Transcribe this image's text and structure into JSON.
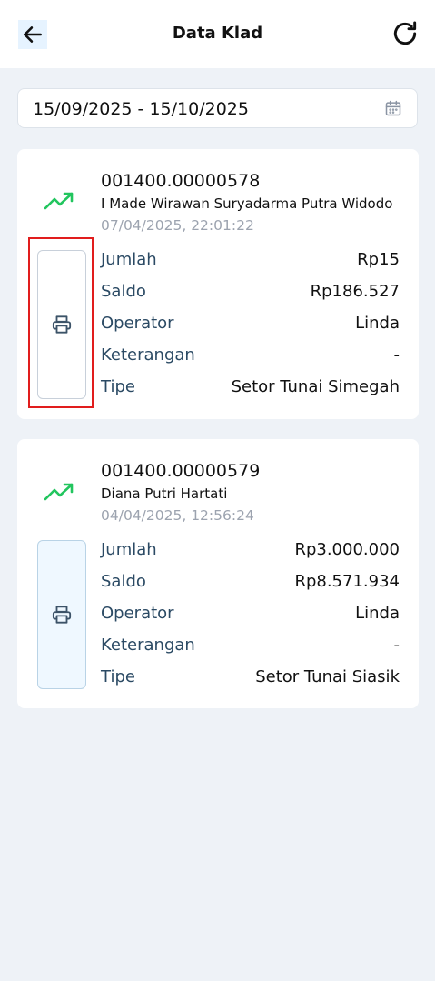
{
  "header": {
    "title": "Data Klad",
    "back_icon": "arrow-left-icon",
    "refresh_icon": "refresh-icon"
  },
  "filter": {
    "date_range": "15/09/2025 - 15/10/2025",
    "icon": "calendar-icon"
  },
  "colors": {
    "trend_green": "#22c55e",
    "label_blue": "#2b4a64",
    "timestamp_gray": "#9ca3af",
    "highlight_red": "#e11d1d"
  },
  "transactions": [
    {
      "account": "001400.00000578",
      "name": "I Made Wirawan Suryadarma Putra Widodo",
      "timestamp": "07/04/2025, 22:01:22",
      "details": [
        {
          "label": "Jumlah",
          "value": "Rp15"
        },
        {
          "label": "Saldo",
          "value": "Rp186.527"
        },
        {
          "label": "Operator",
          "value": "Linda"
        },
        {
          "label": "Keterangan",
          "value": "-"
        },
        {
          "label": "Tipe",
          "value": "Setor Tunai Simegah"
        }
      ]
    },
    {
      "account": "001400.00000579",
      "name": "Diana Putri Hartati",
      "timestamp": "04/04/2025, 12:56:24",
      "details": [
        {
          "label": "Jumlah",
          "value": "Rp3.000.000"
        },
        {
          "label": "Saldo",
          "value": "Rp8.571.934"
        },
        {
          "label": "Operator",
          "value": "Linda"
        },
        {
          "label": "Keterangan",
          "value": "-"
        },
        {
          "label": "Tipe",
          "value": "Setor Tunai Siasik"
        }
      ]
    }
  ]
}
